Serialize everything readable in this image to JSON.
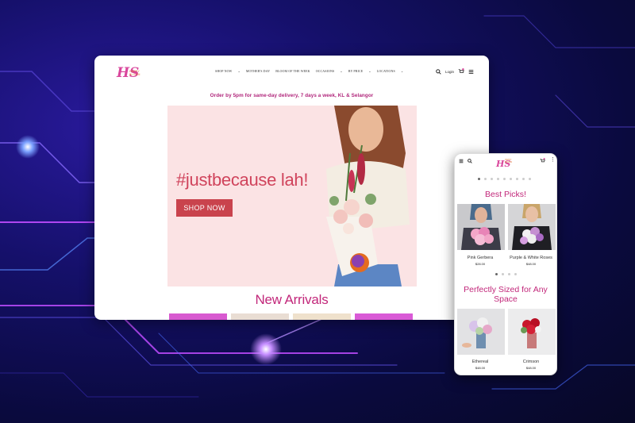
{
  "desktop": {
    "logo": {
      "mark": "HS",
      "text_line1": "HAPPY",
      "text_line2": "BLOOM"
    },
    "nav": [
      {
        "label": "SHOP NOW",
        "has_dropdown": true
      },
      {
        "label": "MOTHER'S DAY",
        "has_dropdown": false
      },
      {
        "label": "BLOOM OF THE WEEK",
        "has_dropdown": false
      },
      {
        "label": "OCCASIONS",
        "has_dropdown": true
      },
      {
        "label": "BY PRICE",
        "has_dropdown": true
      },
      {
        "label": "LOCATIONS",
        "has_dropdown": true
      }
    ],
    "login_label": "Login",
    "cart_count": "0",
    "promo": "Order by 5pm for same-day delivery, 7 days a week, KL & Selangor",
    "hero": {
      "tagline": "#justbecause lah!",
      "button": "SHOP NOW"
    },
    "section_title": "New Arrivals",
    "tile_colors": [
      "#d85ad0",
      "#e9ddd3",
      "#efe1cc",
      "#d95ad6"
    ]
  },
  "phone": {
    "logo": {
      "mark": "HS",
      "text_line1": "HAPPY",
      "text_line2": "BLOOM"
    },
    "cart_count": "0",
    "best_picks_title": "Best Picks!",
    "best_picks": [
      {
        "name": "Pink Gerbera",
        "price": "$28.00"
      },
      {
        "name": "Purple & White Roses",
        "price": "$48.00"
      }
    ],
    "sized_title": "Perfectly Sized for Any Space",
    "sized_items": [
      {
        "name": "Ethereal",
        "price": "$48.00"
      },
      {
        "name": "Crimson",
        "price": "$48.00"
      }
    ]
  },
  "colors": {
    "accent": "#c2277a",
    "button": "#c9434d",
    "hero_bg": "#fbe3e4"
  },
  "icons": [
    "search-icon",
    "cart-icon",
    "menu-icon",
    "chevron-down-icon",
    "more-icon"
  ]
}
